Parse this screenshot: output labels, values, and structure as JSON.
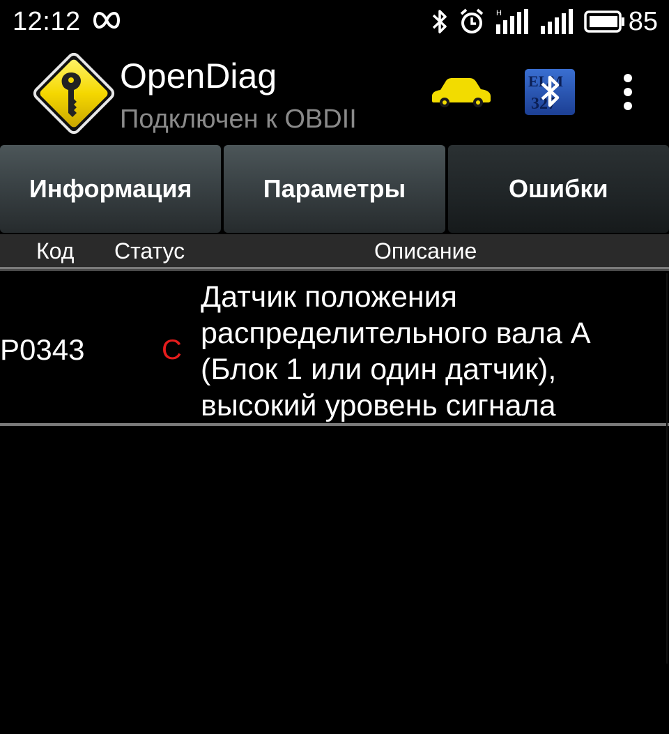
{
  "status_bar": {
    "time": "12:12",
    "battery_percent": "85",
    "icons": [
      "infinity-icon",
      "bluetooth-icon",
      "alarm-icon",
      "signal-icon",
      "signal-icon",
      "battery-icon"
    ]
  },
  "action_bar": {
    "title": "OpenDiag",
    "subtitle": "Подключен к OBDII",
    "icons": [
      "app-logo-key-icon",
      "car-icon",
      "elm327-bluetooth-icon",
      "overflow-menu-icon"
    ],
    "elm_logo_text": "ELM 327"
  },
  "tabs": [
    {
      "label": "Информация",
      "active": false
    },
    {
      "label": "Параметры",
      "active": false
    },
    {
      "label": "Ошибки",
      "active": true
    }
  ],
  "table": {
    "headers": {
      "code": "Код",
      "status": "Статус",
      "description": "Описание"
    },
    "rows": [
      {
        "code": "P0343",
        "status": "C",
        "description": "Датчик положения распределительного вала A (Блок 1 или один датчик), высокий уровень сигнала"
      }
    ]
  },
  "colors": {
    "background": "#000000",
    "status_red": "#e51c1c",
    "subtitle_gray": "#8a8a8a",
    "car_yellow": "#f2dc00",
    "logo_yellow": "#f5d800"
  }
}
